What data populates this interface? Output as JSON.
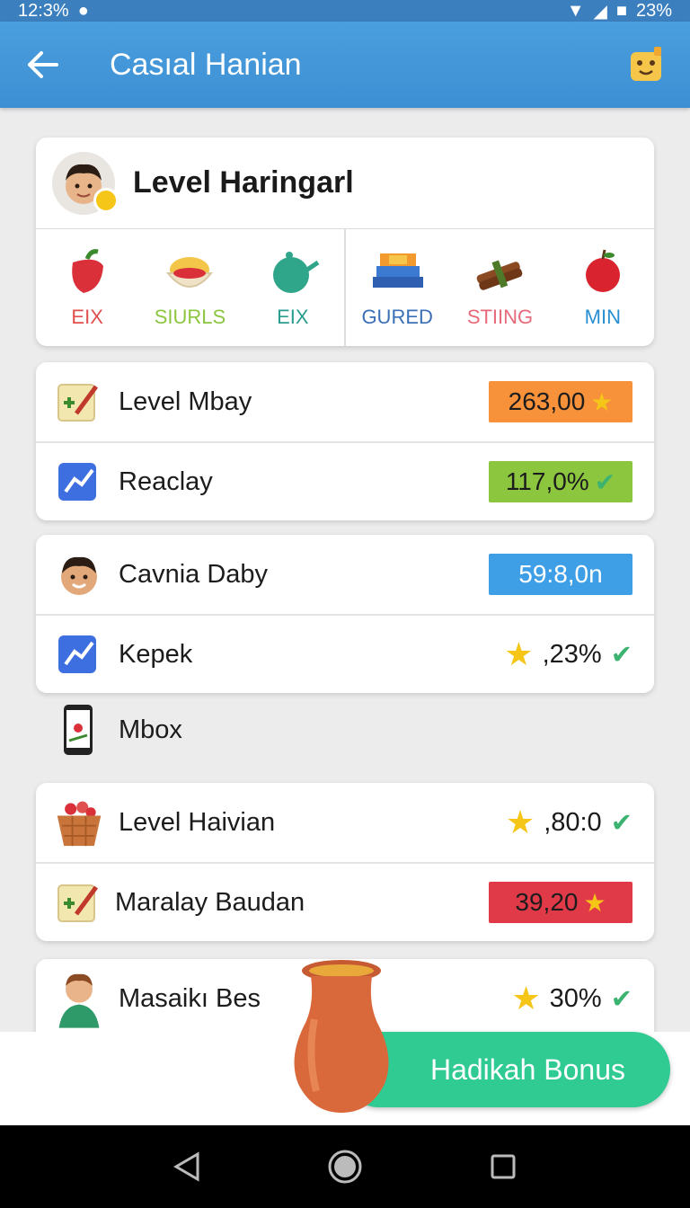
{
  "status": {
    "left_text": "12:3%",
    "right_text": "23%"
  },
  "app_bar": {
    "title": "Casıal Hanian"
  },
  "level_card": {
    "title": "Level Haringarl",
    "categories_left": [
      {
        "label": "EIX",
        "color": "#e0504e",
        "icon": "pepper-icon"
      },
      {
        "label": "SIURLS",
        "color": "#8cc63f",
        "icon": "bowl-icon"
      },
      {
        "label": "EIX",
        "color": "#2a9d8f",
        "icon": "teapot-icon"
      }
    ],
    "categories_right": [
      {
        "label": "GURED",
        "color": "#3b6fb6",
        "icon": "books-icon"
      },
      {
        "label": "STIING",
        "color": "#e66a7a",
        "icon": "cinnamon-icon"
      },
      {
        "label": "MIN",
        "color": "#2a8fd0",
        "icon": "apple-icon"
      }
    ]
  },
  "card1": {
    "rows": [
      {
        "label": "Level Mbay",
        "value": "263,00",
        "icon": "task-icon"
      },
      {
        "label": "Reaclay",
        "value": "117,0%",
        "icon": "chart-icon"
      }
    ]
  },
  "card2": {
    "rows": [
      {
        "label": "Cavnia Daby",
        "value": "59:8,0n",
        "icon": "person-icon"
      },
      {
        "label": "Kepek",
        "value": ",23%",
        "icon": "chart-icon"
      }
    ]
  },
  "mbox": {
    "label": "Mbox",
    "icon": "phone-icon"
  },
  "card3": {
    "rows": [
      {
        "label": "Level Haivian",
        "value": ",80:0",
        "icon": "basket-icon"
      },
      {
        "label": "Maralay Baudan",
        "value": "39,20",
        "icon": "task-icon"
      }
    ]
  },
  "card4": {
    "rows": [
      {
        "label": "Masaikı Bes",
        "value": "30%",
        "icon": "person-icon"
      }
    ]
  },
  "bonus_button": {
    "label": "Hadikah Bonus"
  },
  "colors": {
    "app_bar": "#3d8fd3",
    "bonus": "#2fcb92",
    "check": "#3cb371",
    "star": "#f5c518"
  }
}
